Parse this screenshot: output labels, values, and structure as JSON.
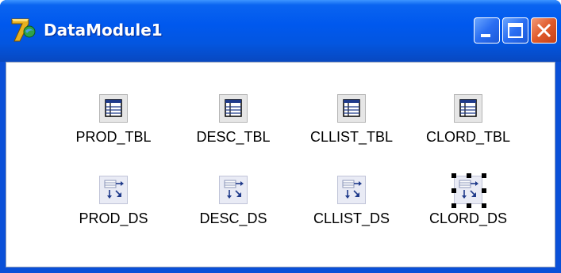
{
  "window": {
    "title": "DataModule1",
    "title_bar_color": "#0058ee",
    "buttons": {
      "minimize": "minimize-icon",
      "maximize": "maximize-icon",
      "close": "close-icon"
    }
  },
  "components": {
    "tables": [
      {
        "label": "PROD_TBL",
        "icon": "table-icon"
      },
      {
        "label": "DESC_TBL",
        "icon": "table-icon"
      },
      {
        "label": "CLLIST_TBL",
        "icon": "table-icon"
      },
      {
        "label": "CLORD_TBL",
        "icon": "table-icon"
      }
    ],
    "datasources": [
      {
        "label": "PROD_DS",
        "icon": "datasource-icon"
      },
      {
        "label": "DESC_DS",
        "icon": "datasource-icon"
      },
      {
        "label": "CLLIST_DS",
        "icon": "datasource-icon"
      },
      {
        "label": "CLORD_DS",
        "icon": "datasource-icon",
        "selected": true
      }
    ]
  }
}
